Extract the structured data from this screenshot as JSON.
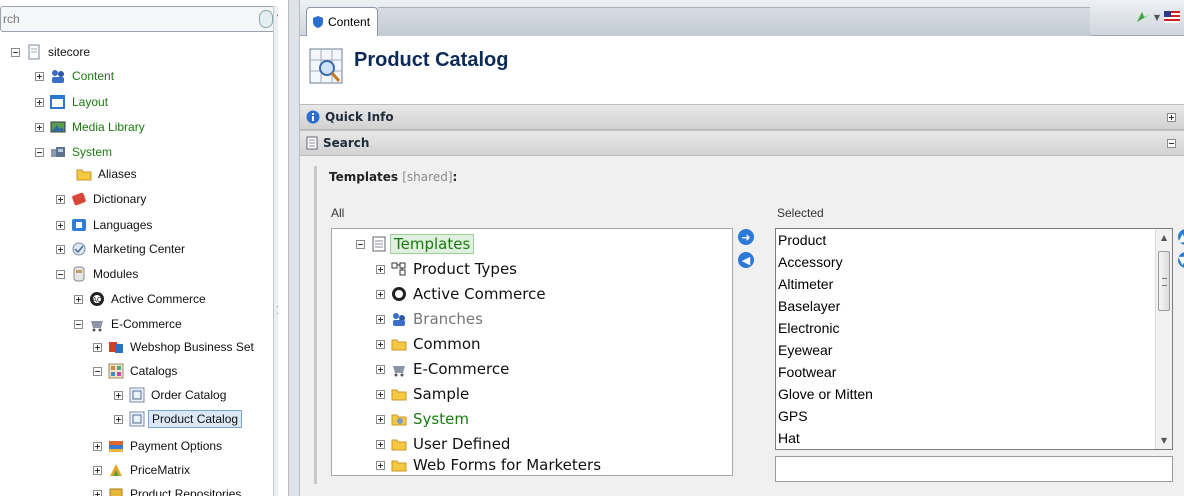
{
  "search": {
    "value": "rch"
  },
  "tree": {
    "items": [
      {
        "label": "sitecore",
        "icon": "page-icon"
      },
      {
        "label": "Content",
        "icon": "content-people-icon"
      },
      {
        "label": "Layout",
        "icon": "layout-window-icon"
      },
      {
        "label": "Media Library",
        "icon": "media-image-icon"
      },
      {
        "label": "System",
        "icon": "system-icon"
      },
      {
        "label": "Aliases",
        "icon": "folder-icon"
      },
      {
        "label": "Dictionary",
        "icon": "dictionary-book-icon"
      },
      {
        "label": "Languages",
        "icon": "languages-flag-icon"
      },
      {
        "label": "Marketing Center",
        "icon": "marketing-center-icon"
      },
      {
        "label": "Modules",
        "icon": "modules-icon"
      },
      {
        "label": "Active Commerce",
        "icon": "active-commerce-icon"
      },
      {
        "label": "E-Commerce",
        "icon": "e-commerce-icon"
      },
      {
        "label": "Webshop Business Set",
        "icon": "webshop-icon"
      },
      {
        "label": "Catalogs",
        "icon": "catalogs-icon"
      },
      {
        "label": "Order Catalog",
        "icon": "catalog-page-icon"
      },
      {
        "label": "Product Catalog",
        "icon": "catalog-page-icon"
      },
      {
        "label": "Payment Options",
        "icon": "payment-icon"
      },
      {
        "label": "PriceMatrix",
        "icon": "price-matrix-icon"
      },
      {
        "label": "Product Repositories",
        "icon": "product-repositories-icon"
      }
    ]
  },
  "tab": {
    "label": "Content"
  },
  "header": {
    "title": "Product Catalog"
  },
  "sections": {
    "quick_info": "Quick Info",
    "search": "Search"
  },
  "field": {
    "label": "Templates",
    "shared": "[shared]",
    "colon": ":",
    "all_label": "All",
    "selected_label": "Selected"
  },
  "all_tree": [
    {
      "label": "Templates",
      "icon": "templates-icon"
    },
    {
      "label": "Product Types",
      "icon": "product-types-icon"
    },
    {
      "label": "Active Commerce",
      "icon": "active-commerce-icon"
    },
    {
      "label": "Branches",
      "icon": "branches-icon"
    },
    {
      "label": "Common",
      "icon": "folder-icon"
    },
    {
      "label": "E-Commerce",
      "icon": "e-commerce-icon"
    },
    {
      "label": "Sample",
      "icon": "folder-icon"
    },
    {
      "label": "System",
      "icon": "system-folder-icon"
    },
    {
      "label": "User Defined",
      "icon": "folder-icon"
    },
    {
      "label": "Web Forms for Marketers",
      "icon": "folder-icon"
    }
  ],
  "selected_items": [
    "Product",
    "Accessory",
    "Altimeter",
    "Baselayer",
    "Electronic",
    "Eyewear",
    "Footwear",
    "Glove or Mitten",
    "GPS",
    "Hat"
  ],
  "colors": {
    "accent_blue": "#2c7ad8",
    "title_navy": "#0b2a57",
    "green_text": "#1a7a10"
  }
}
